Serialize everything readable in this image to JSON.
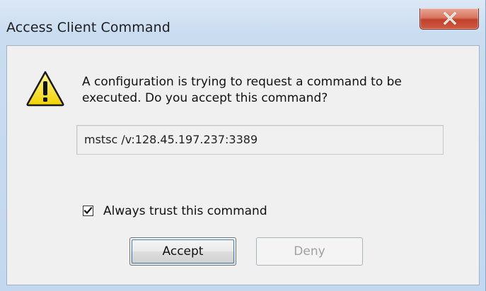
{
  "window": {
    "title": "Access Client Command",
    "close_icon": "close-icon"
  },
  "dialog": {
    "icon": "warning-icon",
    "message_line1": "A configuration is trying to request a command to be",
    "message_line2": "executed. Do you accept this command?",
    "command": "mstsc /v:128.45.197.237:3389",
    "checkbox_label": "Always trust this command",
    "checkbox_checked": true,
    "accept_label": "Accept",
    "deny_label": "Deny",
    "deny_enabled": false
  },
  "colors": {
    "close_button": "#c0402c",
    "warning_yellow": "#f7e31f"
  }
}
